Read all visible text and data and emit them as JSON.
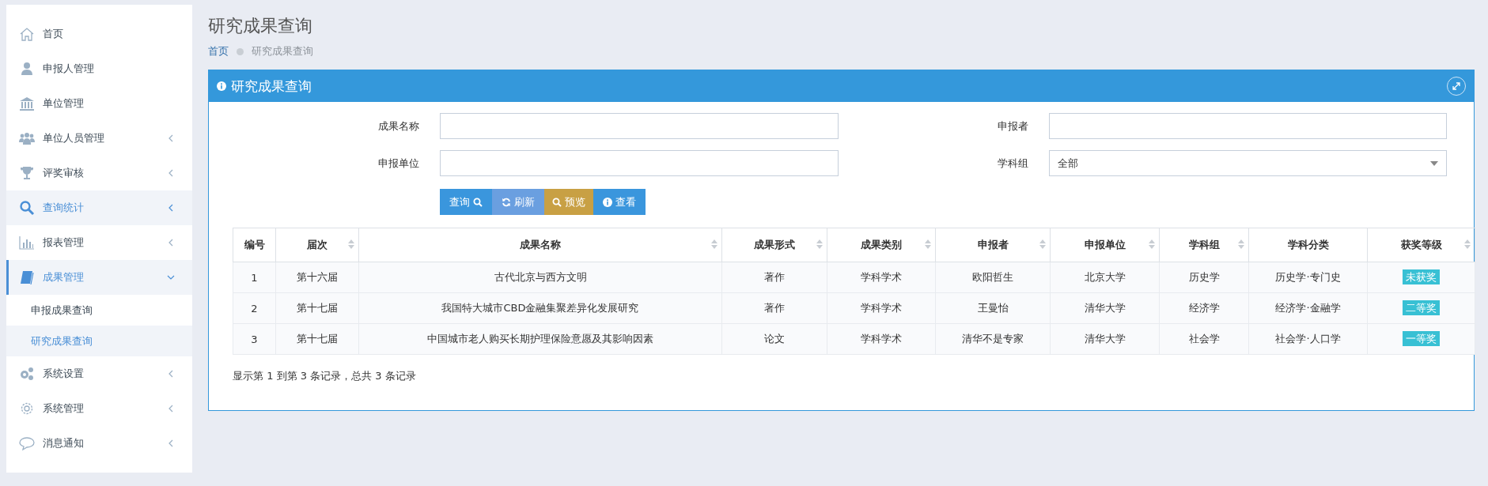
{
  "sidebar": {
    "items": [
      {
        "label": "首页",
        "selected": false
      },
      {
        "label": "申报人管理",
        "selected": false
      },
      {
        "label": "单位管理",
        "selected": false
      },
      {
        "label": "单位人员管理",
        "selected": false,
        "expanded": false
      },
      {
        "label": "评奖审核",
        "selected": false,
        "expanded": false
      },
      {
        "label": "查询统计",
        "selected": true,
        "expanded": false
      },
      {
        "label": "报表管理",
        "selected": false,
        "expanded": false
      },
      {
        "label": "成果管理",
        "selected": true,
        "expanded": true,
        "children": [
          {
            "label": "申报成果查询",
            "selected": false
          },
          {
            "label": "研究成果查询",
            "selected": true
          }
        ]
      },
      {
        "label": "系统设置",
        "selected": false,
        "expanded": false
      },
      {
        "label": "系统管理",
        "selected": false,
        "expanded": false
      },
      {
        "label": "消息通知",
        "selected": false,
        "expanded": false
      }
    ]
  },
  "page_title": "研究成果查询",
  "breadcrumb": [
    "首页",
    "研究成果查询"
  ],
  "panel": {
    "title": "研究成果查询",
    "fields": [
      {
        "label": "成果名称",
        "kind": "text"
      },
      {
        "label": "申报者",
        "kind": "text"
      },
      {
        "label": "申报单位",
        "kind": "text"
      },
      {
        "label": "学科组",
        "kind": "select",
        "value": "全部"
      }
    ],
    "buttons": [
      {
        "label": "查询",
        "kind": "query"
      },
      {
        "label": "刷新",
        "kind": "refresh"
      },
      {
        "label": "预览",
        "kind": "preview"
      },
      {
        "label": "查看",
        "kind": "view"
      }
    ],
    "table": {
      "columns": [
        {
          "label": "编号",
          "sortable": false
        },
        {
          "label": "届次",
          "sortable": true
        },
        {
          "label": "成果名称",
          "sortable": true
        },
        {
          "label": "成果形式",
          "sortable": true
        },
        {
          "label": "成果类别",
          "sortable": true
        },
        {
          "label": "申报者",
          "sortable": true
        },
        {
          "label": "申报单位",
          "sortable": true
        },
        {
          "label": "学科组",
          "sortable": true
        },
        {
          "label": "学科分类",
          "sortable": false
        },
        {
          "label": "获奖等级",
          "sortable": true
        }
      ],
      "rows": [
        [
          "1",
          "第十六届",
          "古代北京与西方文明",
          "著作",
          "学科学术",
          "欧阳哲生",
          "北京大学",
          "历史学",
          "历史学·专门史",
          "未获奖"
        ],
        [
          "2",
          "第十七届",
          "我国特大城市CBD金融集聚差异化发展研究",
          "著作",
          "学科学术",
          "王曼怡",
          "清华大学",
          "经济学",
          "经济学·金融学",
          "二等奖"
        ],
        [
          "3",
          "第十七届",
          "中国城市老人购买长期护理保险意愿及其影响因素",
          "论文",
          "学科学术",
          "清华不是专家",
          "清华大学",
          "社会学",
          "社会学·人口学",
          "一等奖"
        ]
      ]
    },
    "summary": "显示第 1 到第 3 条记录，总共 3 条记录"
  }
}
